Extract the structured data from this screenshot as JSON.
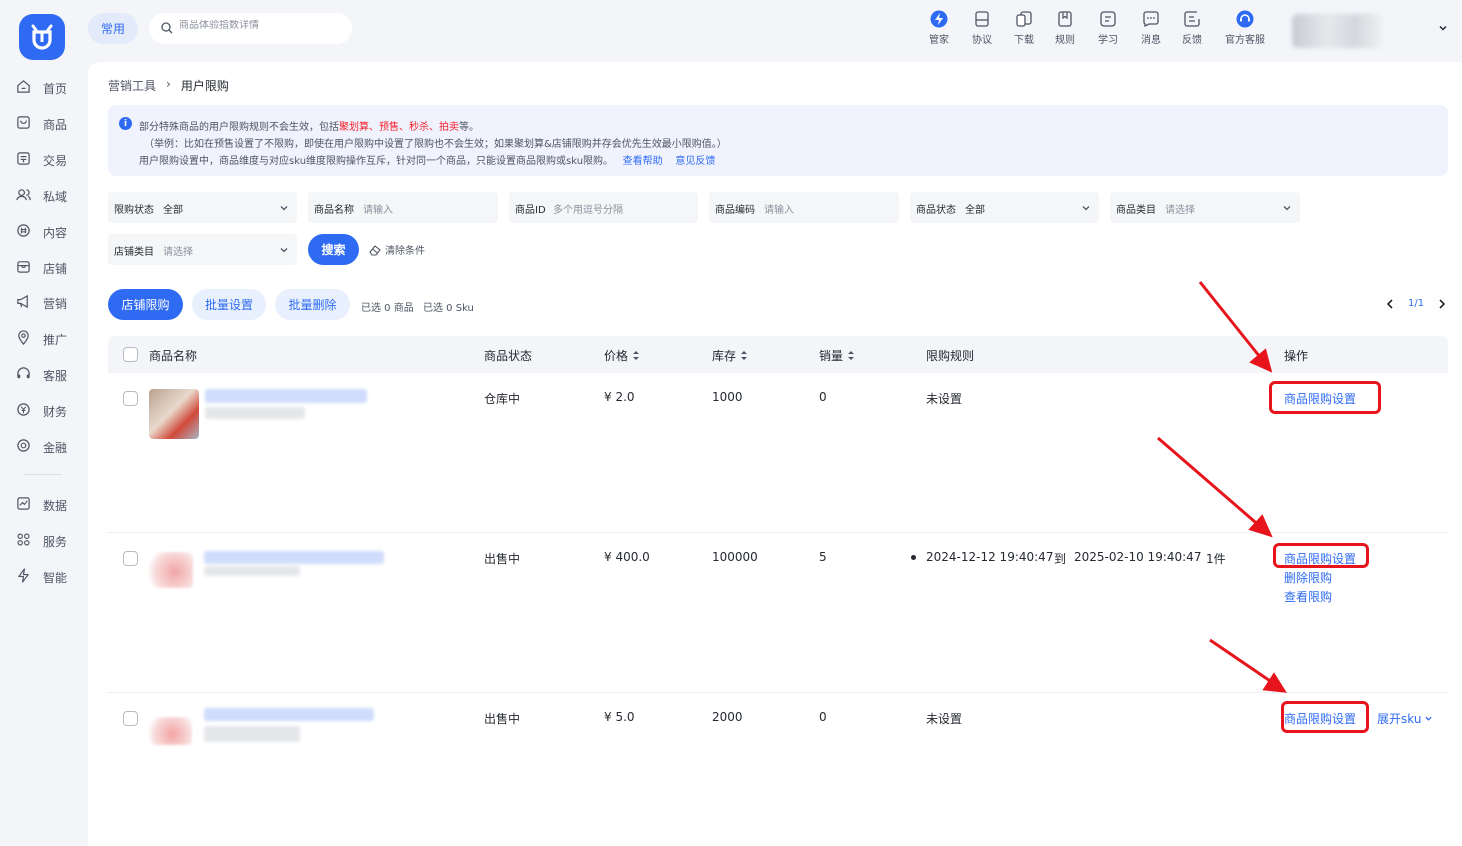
{
  "sidebar": {
    "items": [
      {
        "label": "首页",
        "icon": "home-icon"
      },
      {
        "label": "商品",
        "icon": "product-icon"
      },
      {
        "label": "交易",
        "icon": "trade-icon"
      },
      {
        "label": "私域",
        "icon": "users-icon"
      },
      {
        "label": "内容",
        "icon": "content-icon"
      },
      {
        "label": "店铺",
        "icon": "store-icon"
      },
      {
        "label": "营销",
        "icon": "megaphone-icon"
      },
      {
        "label": "推广",
        "icon": "location-icon"
      },
      {
        "label": "客服",
        "icon": "headset-icon"
      },
      {
        "label": "财务",
        "icon": "finance-icon"
      },
      {
        "label": "金融",
        "icon": "coin-icon"
      },
      {
        "label": "数据",
        "icon": "chart-icon"
      },
      {
        "label": "服务",
        "icon": "grid-icon"
      },
      {
        "label": "智能",
        "icon": "bolt-icon"
      }
    ]
  },
  "topbar": {
    "common_tab": "常用",
    "search_placeholder": "商品体验指数详情",
    "tools": [
      {
        "label": "管家",
        "icon": "butler-icon"
      },
      {
        "label": "协议",
        "icon": "agreement-icon"
      },
      {
        "label": "下载",
        "icon": "download-icon"
      },
      {
        "label": "规则",
        "icon": "rules-icon"
      },
      {
        "label": "学习",
        "icon": "learn-icon"
      },
      {
        "label": "消息",
        "icon": "message-icon"
      },
      {
        "label": "反馈",
        "icon": "feedback-icon"
      },
      {
        "label": "官方客服",
        "icon": "support-icon"
      }
    ]
  },
  "breadcrumb": {
    "parent": "营销工具",
    "sep": "›",
    "current": "用户限购"
  },
  "notice": {
    "line1_pre": "部分特殊商品的用户限购规则不会生效，包括",
    "line1_red": "聚划算、预售、秒杀、拍卖",
    "line1_post": "等。",
    "line2": "（举例：比如在预售设置了不限购，即使在用户限购中设置了限购也不会生效；如果聚划算&店铺限购并存会优先生效最小限购值。）",
    "line3": "用户限购设置中，商品维度与对应sku维度限购操作互斥，针对同一个商品，只能设置商品限购或sku限购。",
    "help": "查看帮助",
    "feedback": "意见反馈"
  },
  "filters": {
    "limit_status": {
      "label": "限购状态",
      "value": "全部"
    },
    "product_name": {
      "label": "商品名称",
      "placeholder": "请输入"
    },
    "product_id": {
      "label": "商品ID",
      "placeholder": "多个用逗号分隔"
    },
    "product_code": {
      "label": "商品编码",
      "placeholder": "请输入"
    },
    "product_status": {
      "label": "商品状态",
      "value": "全部"
    },
    "product_category": {
      "label": "商品类目",
      "placeholder": "请选择"
    },
    "store_category": {
      "label": "店铺类目",
      "placeholder": "请选择"
    },
    "search_button": "搜索",
    "clear_button": "清除条件"
  },
  "actions": {
    "store_limit": "店铺限购",
    "batch_set": "批量设置",
    "batch_delete": "批量删除",
    "selected_products": "已选 0 商品",
    "selected_sku": "已选 0 Sku"
  },
  "pager": {
    "text": "1/1"
  },
  "table": {
    "columns": [
      "商品名称",
      "商品状态",
      "价格",
      "库存",
      "销量",
      "限购规则",
      "操作"
    ],
    "rows": [
      {
        "status": "仓库中",
        "price": "¥ 2.0",
        "stock": "1000",
        "sales": "0",
        "rule": "未设置",
        "ops": [
          "商品限购设置"
        ]
      },
      {
        "status": "出售中",
        "price": "¥ 400.0",
        "stock": "100000",
        "sales": "5",
        "rule_start": "2024-12-12 19:40:47",
        "rule_to": "到",
        "rule_end": "2025-02-10 19:40:47",
        "rule_qty": "1件",
        "ops": [
          "商品限购设置",
          "删除限购",
          "查看限购"
        ]
      },
      {
        "status": "出售中",
        "price": "¥ 5.0",
        "stock": "2000",
        "sales": "0",
        "rule": "未设置",
        "ops": [
          "商品限购设置",
          "展开sku"
        ]
      }
    ]
  },
  "colors": {
    "primary": "#2f6bf2",
    "annotation_red": "#e8141c",
    "warning_red": "#f5222d"
  }
}
